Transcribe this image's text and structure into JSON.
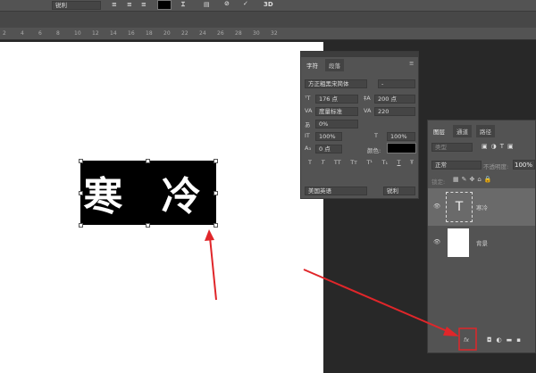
{
  "toolbar": {
    "font_aa": "锐利",
    "items": [
      "align-left",
      "align-center",
      "align-right",
      "text-color",
      "warp-text",
      "panels",
      "cancel",
      "commit",
      "3d"
    ],
    "label_3d": "3D",
    "color": "#000000"
  },
  "ruler": {
    "labels": [
      "2",
      "4",
      "6",
      "8",
      "10",
      "12",
      "14",
      "16",
      "18",
      "20",
      "22",
      "24",
      "26",
      "28",
      "30",
      "32"
    ]
  },
  "canvas": {
    "text": "寒 冷"
  },
  "character_panel": {
    "tabs": [
      "字符",
      "段落"
    ],
    "font_family": "方正粗黑宋简体",
    "font_style": "-",
    "font_size": "176 点",
    "leading": "200 点",
    "kerning": "度量标准",
    "tracking": "220",
    "tsume": "0%",
    "vscale": "100%",
    "hscale": "100%",
    "baseline": "0 点",
    "color_label": "颜色:",
    "language": "美国英语",
    "aa": "锐利",
    "styles": [
      "T",
      "T",
      "TT",
      "Tт",
      "T¹",
      "T₁",
      "T",
      "Ŧ"
    ]
  },
  "layers_panel": {
    "tabs": [
      "图层",
      "通道",
      "路径"
    ],
    "filter": "类型",
    "blend": "正常",
    "opacity_label": "不透明度:",
    "opacity": "100%",
    "lock_label": "锁定:",
    "layers": [
      {
        "name": "寒冷",
        "thumb": "T"
      },
      {
        "name": "背景",
        "thumb": ""
      }
    ],
    "footer_fx": "fx"
  },
  "colors": {
    "annotation": "#e0262a"
  }
}
